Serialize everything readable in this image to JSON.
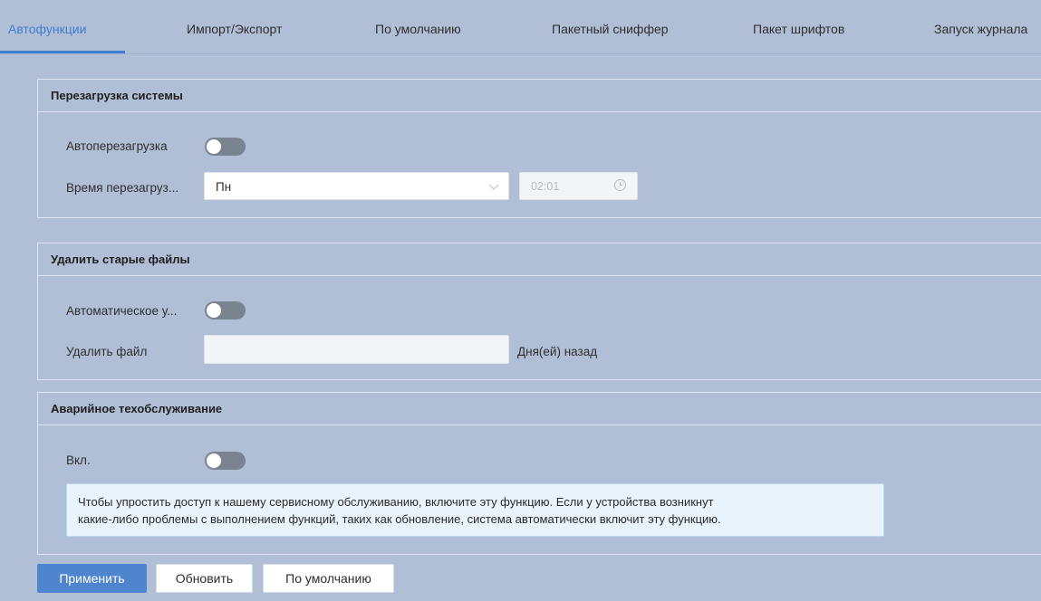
{
  "tabs": [
    {
      "label": "Автофункции",
      "active": true
    },
    {
      "label": "Импорт/Экспорт"
    },
    {
      "label": "По умолчанию"
    },
    {
      "label": "Пакетный сниффер"
    },
    {
      "label": "Пакет шрифтов"
    },
    {
      "label": "Запуск журнала"
    }
  ],
  "reboot": {
    "title": "Перезагрузка системы",
    "auto_label": "Автоперезагрузка",
    "auto_enabled": false,
    "time_label": "Время перезагруз...",
    "day_value": "Пн",
    "time_value": "02:01"
  },
  "delete_files": {
    "title": "Удалить старые файлы",
    "auto_label": "Автоматическое у...",
    "auto_enabled": false,
    "delete_label": "Удалить файл",
    "delete_value": "",
    "suffix": "Дня(ей) назад"
  },
  "emergency": {
    "title": "Аварийное техобслуживание",
    "enable_label": "Вкл.",
    "enabled": false,
    "note_line1": "Чтобы упростить доступ к нашему сервисному обслуживанию, включите эту функцию. Если у устройства возникнут",
    "note_line2": "какие-либо проблемы с выполнением функций, таких как обновление, система автоматически включит эту функцию."
  },
  "buttons": {
    "apply": "Применить",
    "refresh": "Обновить",
    "default": "По умолчанию"
  },
  "colors": {
    "accent": "#3f7dd1",
    "background": "#b1bfd6",
    "primary_button": "#4f84cf",
    "toggle_off": "#7a8390"
  },
  "icons": {
    "select": "chevron-down-icon",
    "time": "clock-icon"
  }
}
